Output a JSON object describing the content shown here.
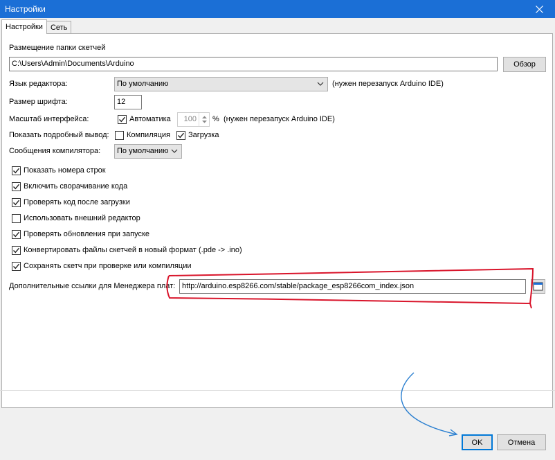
{
  "window": {
    "title": "Настройки"
  },
  "tabs": [
    {
      "label": "Настройки",
      "active": true
    },
    {
      "label": "Сеть",
      "active": false
    }
  ],
  "sketchbook": {
    "label": "Размещение папки скетчей",
    "path": "C:\\Users\\Admin\\Documents\\Arduino",
    "browse_label": "Обзор"
  },
  "editor_language": {
    "label": "Язык редактора:",
    "value": "По умолчанию",
    "note": "(нужен перезапуск Arduino IDE)"
  },
  "font_size": {
    "label": "Размер шрифта:",
    "value": "12"
  },
  "scale": {
    "label": "Масштаб интерфейса:",
    "auto_label": "Автоматика",
    "auto_checked": true,
    "value": "100",
    "unit": "%",
    "note": "(нужен перезапуск Arduino IDE)"
  },
  "verbose": {
    "label": "Показать подробный вывод:",
    "compile_label": "Компиляция",
    "compile_checked": false,
    "upload_label": "Загрузка",
    "upload_checked": true
  },
  "compiler_warnings": {
    "label": "Сообщения компилятора:",
    "value": "По умолчанию"
  },
  "options": [
    {
      "label": "Показать номера строк",
      "checked": true
    },
    {
      "label": "Включить сворачивание кода",
      "checked": true
    },
    {
      "label": "Проверять код после загрузки",
      "checked": true
    },
    {
      "label": "Использовать внешний редактор",
      "checked": false
    },
    {
      "label": "Проверять обновления при запуске",
      "checked": true
    },
    {
      "label": "Конвертировать файлы скетчей в новый формат (.pde -> .ino)",
      "checked": true
    },
    {
      "label": "Сохранять скетч при проверке или компиляции",
      "checked": true
    }
  ],
  "board_urls": {
    "label": "Дополнительные ссылки для Менеджера плат:",
    "value": "http://arduino.esp8266.com/stable/package_esp8266com_index.json"
  },
  "footer": {
    "ok_label": "OK",
    "cancel_label": "Отмена"
  },
  "colors": {
    "titlebar": "#1b6fd6",
    "annotation_red": "#d9152b",
    "annotation_blue": "#2a7fd0"
  }
}
